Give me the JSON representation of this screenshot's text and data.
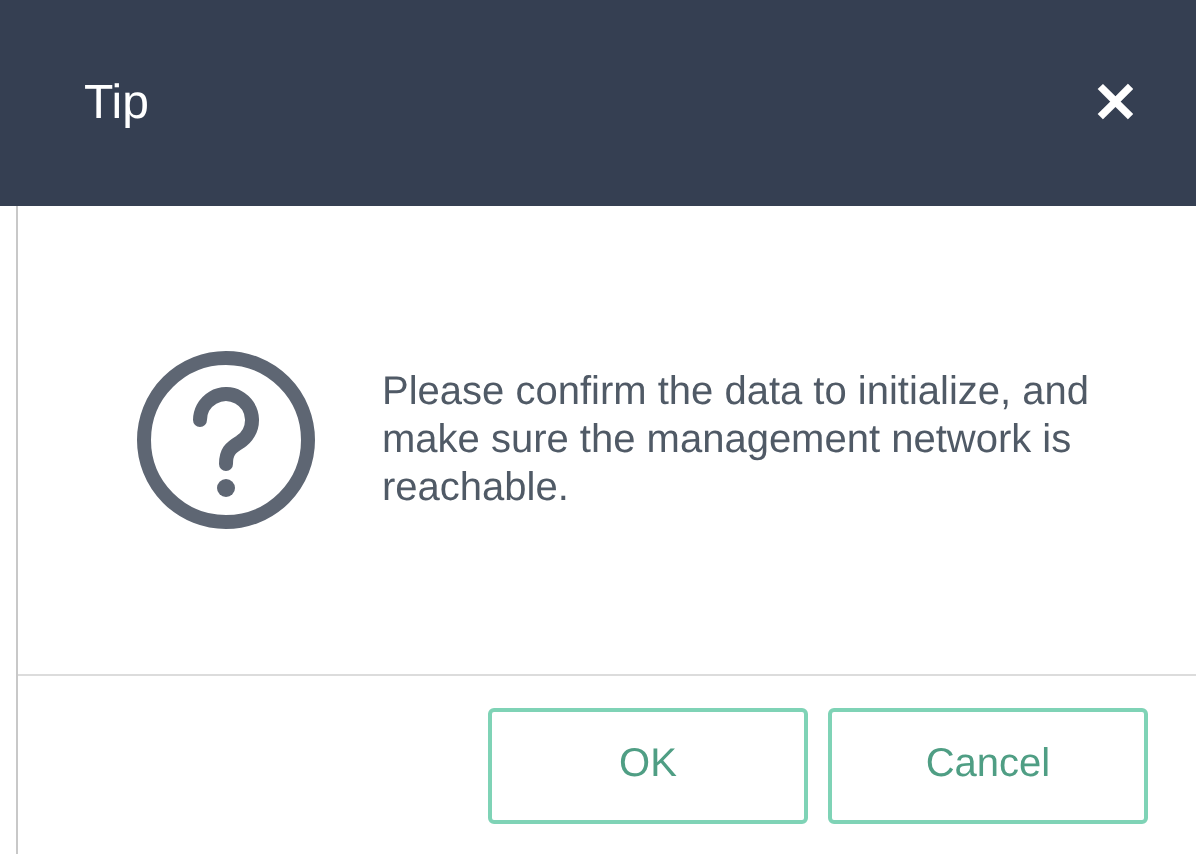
{
  "window": {
    "title": "Tip",
    "close": "✕"
  },
  "message": "Please confirm the data to initialize, and make sure the management network is reachable.",
  "buttons": [
    {
      "label": "OK"
    },
    {
      "label": "Cancel"
    }
  ]
}
